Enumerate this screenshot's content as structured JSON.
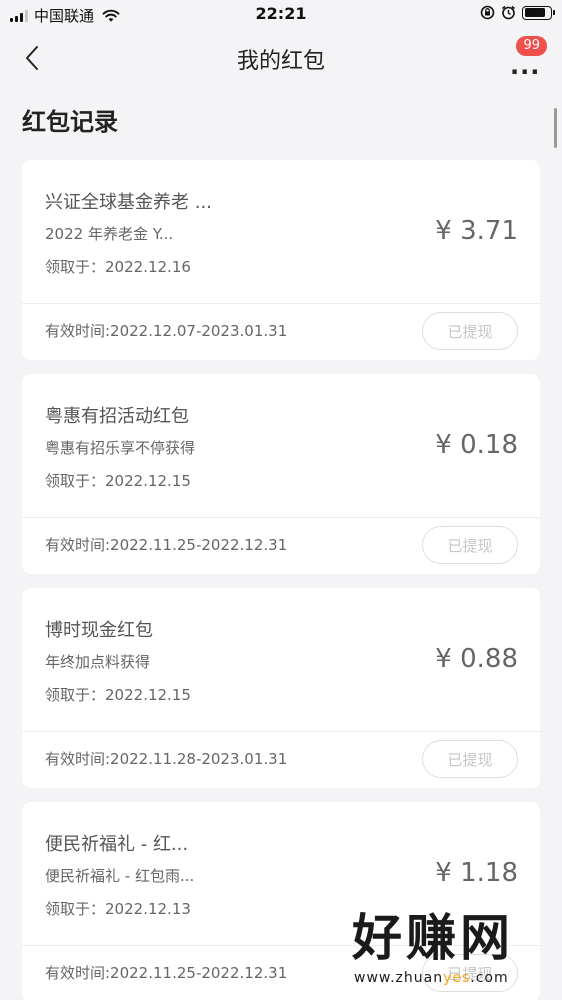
{
  "status_bar": {
    "carrier": "中国联通",
    "time": "22:21"
  },
  "nav": {
    "title": "我的红包",
    "badge": "99"
  },
  "section_title": "红包记录",
  "packets": [
    {
      "name": "兴证全球基金养老 ...",
      "source": "2022 年养老金 Y...",
      "date_label": "领取于：",
      "date": "2022.12.16",
      "amount": "¥ 3.71",
      "validity": "有效时间:2022.12.07-2023.01.31",
      "status": "已提现"
    },
    {
      "name": "粤惠有招活动红包",
      "source": "粤惠有招乐享不停获得",
      "date_label": "领取于：",
      "date": "2022.12.15",
      "amount": "¥ 0.18",
      "validity": "有效时间:2022.11.25-2022.12.31",
      "status": "已提现"
    },
    {
      "name": "博时现金红包",
      "source": "年终加点料获得",
      "date_label": "领取于：",
      "date": "2022.12.15",
      "amount": "¥ 0.88",
      "validity": "有效时间:2022.11.28-2023.01.31",
      "status": "已提现"
    },
    {
      "name": "便民祈福礼 - 红...",
      "source": "便民祈福礼 - 红包雨...",
      "date_label": "领取于：",
      "date": "2022.12.13",
      "amount": "¥ 1.18",
      "validity": "有效时间:2022.11.25-2022.12.31",
      "status": "已提现"
    }
  ],
  "watermark": {
    "text": "好赚网",
    "url_prefix": "www.zhuan",
    "url_highlight": "yes",
    "url_suffix": ".com"
  },
  "colors": {
    "background": "#f4f4f6",
    "badge": "#f0504d",
    "watermark_highlight": "#f2a11b"
  },
  "icons": [
    "signal-icon",
    "wifi-icon",
    "orientation-lock-icon",
    "alarm-icon",
    "battery-icon",
    "back-arrow-icon",
    "more-icon"
  ]
}
